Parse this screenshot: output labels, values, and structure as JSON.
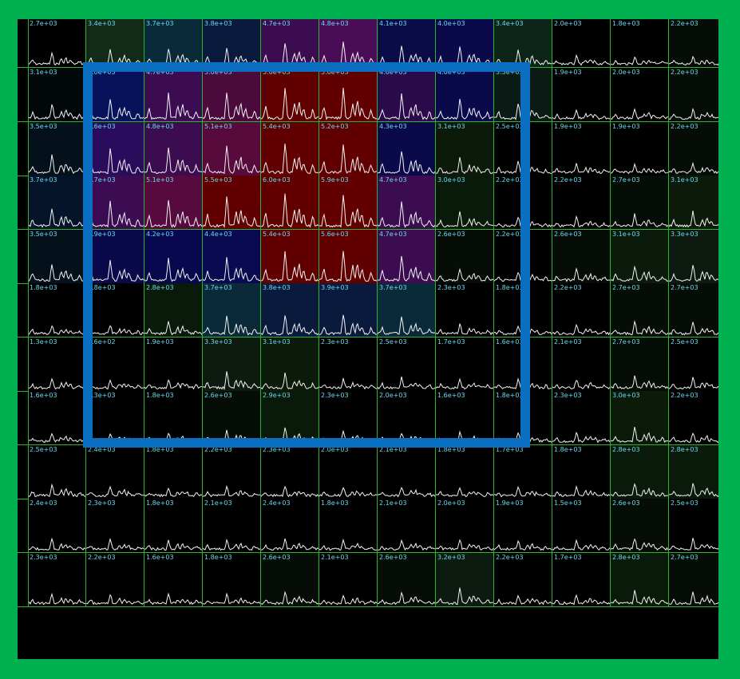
{
  "grid": {
    "rows": [
      {
        "values": [
          "2.7e+03",
          "3.4e+03",
          "3.7e+03",
          "3.8e+03",
          "4.7e+03",
          "4.8e+03",
          "4.1e+03",
          "4.0e+03",
          "3.4e+03",
          "2.0e+03",
          "1.8e+03",
          "2.2e+03"
        ],
        "colors": [
          "#000000",
          "#122a18",
          "#0a2a3a",
          "#0a1a3c",
          "#3c0c50",
          "#4a0c56",
          "#0a0c48",
          "#0a0a4a",
          "#0d2418",
          "#000000",
          "#000000",
          "#060c06"
        ]
      },
      {
        "values": [
          "3.1e+03",
          "4.0e+03",
          "4.7e+03",
          "5.0e+03",
          "5.6e+03",
          "5.6e+03",
          "4.6e+03",
          "4.0e+03",
          "3.3e+03",
          "1.9e+03",
          "2.0e+03",
          "2.2e+03"
        ],
        "colors": [
          "#02080a",
          "#06125a",
          "#3c0c52",
          "#4a0a3c",
          "#600000",
          "#600000",
          "#2a0a4a",
          "#0a0a4a",
          "#0a1a14",
          "#000000",
          "#000000",
          "#060c06"
        ]
      },
      {
        "values": [
          "3.5e+03",
          "4.6e+03",
          "4.8e+03",
          "5.1e+03",
          "5.4e+03",
          "5.2e+03",
          "4.3e+03",
          "3.1e+03",
          "2.5e+03",
          "1.9e+03",
          "1.9e+03",
          "2.2e+03"
        ],
        "colors": [
          "#04101a",
          "#2a0c5c",
          "#3c0c50",
          "#580a3c",
          "#600000",
          "#600000",
          "#0a0a4a",
          "#0c1a0a",
          "#000000",
          "#000000",
          "#000000",
          "#060c06"
        ]
      },
      {
        "values": [
          "3.7e+03",
          "4.7e+03",
          "5.1e+03",
          "5.5e+03",
          "6.0e+03",
          "5.9e+03",
          "4.7e+03",
          "3.0e+03",
          "2.2e+03",
          "2.2e+03",
          "2.7e+03",
          "3.1e+03"
        ],
        "colors": [
          "#06142a",
          "#3c0c52",
          "#560a40",
          "#600000",
          "#620000",
          "#620000",
          "#3c0c50",
          "#0a1a0a",
          "#000000",
          "#000000",
          "#060c06",
          "#0c1a0c"
        ]
      },
      {
        "values": [
          "3.5e+03",
          "3.9e+03",
          "4.2e+03",
          "4.4e+03",
          "5.4e+03",
          "5.6e+03",
          "4.7e+03",
          "2.6e+03",
          "2.2e+03",
          "2.6e+03",
          "3.1e+03",
          "3.3e+03"
        ],
        "colors": [
          "#04101a",
          "#0a0a4a",
          "#08084e",
          "#0a0a50",
          "#600000",
          "#600000",
          "#3c0c50",
          "#060c06",
          "#000000",
          "#060c06",
          "#0c1a0c",
          "#0c1a10"
        ]
      },
      {
        "values": [
          "1.8e+03",
          "1.8e+03",
          "2.8e+03",
          "3.7e+03",
          "3.8e+03",
          "3.9e+03",
          "3.7e+03",
          "2.3e+03",
          "1.8e+03",
          "2.2e+03",
          "2.7e+03",
          "2.7e+03"
        ],
        "colors": [
          "#000000",
          "#000000",
          "#0a1a0a",
          "#0a2a3a",
          "#0a1a3c",
          "#0a1a3c",
          "#0a2a3a",
          "#000000",
          "#000000",
          "#000000",
          "#060c06",
          "#060c06"
        ]
      },
      {
        "values": [
          "1.3e+03",
          "9.6e+02",
          "1.9e+03",
          "3.3e+03",
          "3.1e+03",
          "2.3e+03",
          "2.5e+03",
          "1.7e+03",
          "1.6e+03",
          "2.1e+03",
          "2.7e+03",
          "2.5e+03"
        ],
        "colors": [
          "#000000",
          "#000000",
          "#000000",
          "#0c1a10",
          "#0c1a0a",
          "#000000",
          "#000000",
          "#000000",
          "#000000",
          "#000000",
          "#060c06",
          "#000000"
        ]
      },
      {
        "values": [
          "1.6e+03",
          "1.3e+03",
          "1.8e+03",
          "2.6e+03",
          "2.9e+03",
          "2.3e+03",
          "2.0e+03",
          "1.6e+03",
          "1.8e+03",
          "2.3e+03",
          "3.0e+03",
          "2.2e+03"
        ],
        "colors": [
          "#000000",
          "#000000",
          "#000000",
          "#060c06",
          "#0a1a0a",
          "#000000",
          "#000000",
          "#000000",
          "#000000",
          "#000000",
          "#0c1a0a",
          "#000000"
        ]
      },
      {
        "values": [
          "2.5e+03",
          "2.4e+03",
          "1.8e+03",
          "2.2e+03",
          "2.3e+03",
          "2.0e+03",
          "2.1e+03",
          "1.8e+03",
          "1.7e+03",
          "1.8e+03",
          "2.8e+03",
          "2.8e+03"
        ],
        "colors": [
          "#000000",
          "#000000",
          "#000000",
          "#000000",
          "#000000",
          "#000000",
          "#000000",
          "#000000",
          "#000000",
          "#000000",
          "#0a1a0a",
          "#0a1a0a"
        ]
      },
      {
        "values": [
          "2.4e+03",
          "2.3e+03",
          "1.8e+03",
          "2.1e+03",
          "2.4e+03",
          "1.8e+03",
          "2.1e+03",
          "2.0e+03",
          "1.9e+03",
          "1.5e+03",
          "2.6e+03",
          "2.5e+03"
        ],
        "colors": [
          "#000000",
          "#000000",
          "#000000",
          "#000000",
          "#000000",
          "#000000",
          "#000000",
          "#000000",
          "#000000",
          "#000000",
          "#060c06",
          "#000000"
        ]
      },
      {
        "values": [
          "2.3e+03",
          "2.2e+03",
          "1.6e+03",
          "1.8e+03",
          "2.6e+03",
          "2.1e+03",
          "2.6e+03",
          "3.2e+03",
          "2.2e+03",
          "1.7e+03",
          "2.8e+03",
          "2.7e+03"
        ],
        "colors": [
          "#000000",
          "#000000",
          "#000000",
          "#000000",
          "#060c06",
          "#000000",
          "#060c06",
          "#0c1a10",
          "#000000",
          "#000000",
          "#0a1a0a",
          "#060c06"
        ]
      }
    ]
  },
  "colors": {
    "frame": "#00b050",
    "gridline": "#2db52d",
    "selection": "#0a6fc0",
    "label": "#68d8f0",
    "trace": "#f2f2f2"
  },
  "icons": {
    "selection_box": "rectangle-outline"
  }
}
